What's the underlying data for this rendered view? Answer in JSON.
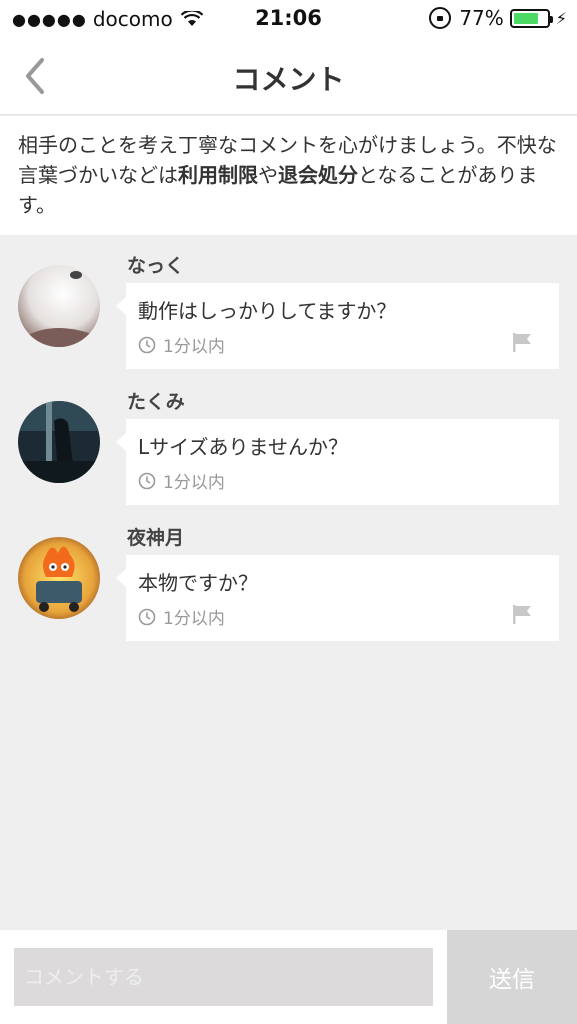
{
  "status_bar": {
    "signal_dots": "●●●●●",
    "carrier": "docomo",
    "time": "21:06",
    "battery_percent": "77%",
    "battery_level": 0.77,
    "battery_color": "#4cd964"
  },
  "nav": {
    "title": "コメント",
    "back_icon": "chevron-left-icon"
  },
  "notice": {
    "text_part1": "相手のことを考え丁寧なコメントを心がけましょう。不快な言葉づかいなどは",
    "bold1": "利用制限",
    "text_part2": "や",
    "bold2": "退会処分",
    "text_part3": "となることがあります。"
  },
  "comments": [
    {
      "username": "なっく",
      "text": "動作はしっかりしてますか？",
      "time": "1分以内",
      "has_flag": true
    },
    {
      "username": "たくみ",
      "text": "Lサイズありませんか？",
      "time": "1分以内",
      "has_flag": false
    },
    {
      "username": "夜神月",
      "text": "本物ですか？",
      "time": "1分以内",
      "has_flag": true
    }
  ],
  "input": {
    "placeholder": "コメントする",
    "send_label": "送信"
  }
}
